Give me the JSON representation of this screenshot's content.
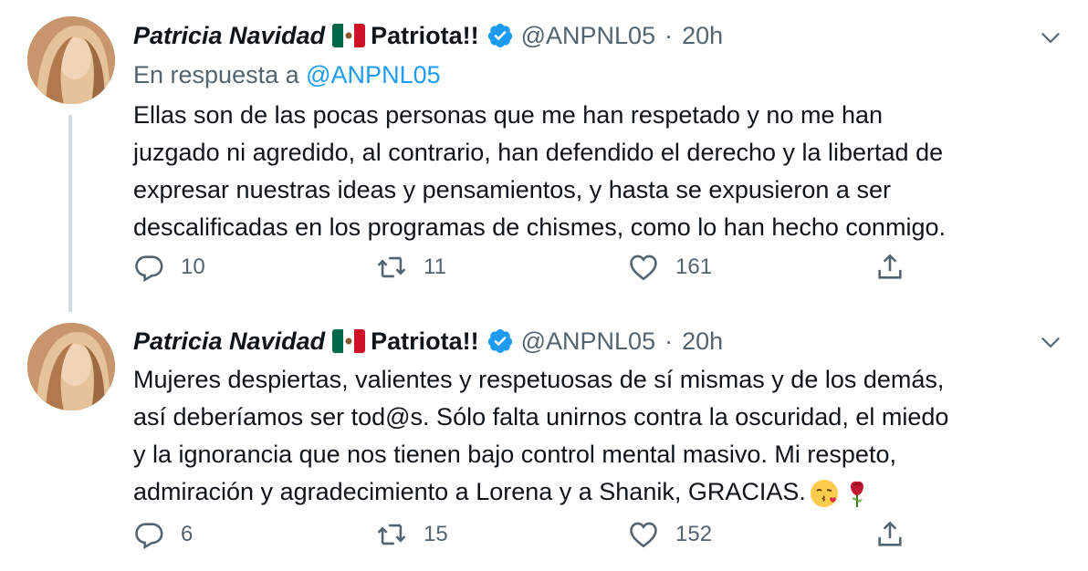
{
  "tweets": [
    {
      "display_name": "Patricia Navidad",
      "name_suffix": "Patriota!!",
      "handle": "@ANPNL05",
      "separator": "·",
      "time": "20h",
      "reply_prefix": "En respuesta a",
      "reply_handle": "@ANPNL05",
      "lines": [
        "Ellas son de las pocas personas que me han respetado y no me han",
        "juzgado ni agredido, al contrario, han defendido el derecho y la libertad de",
        "expresar nuestras ideas y pensamientos, y hasta se expusieron a ser",
        "descalificadas en los programas de chismes, como lo han hecho conmigo."
      ],
      "replies": "10",
      "retweets": "11",
      "likes": "161"
    },
    {
      "display_name": "Patricia Navidad",
      "name_suffix": "Patriota!!",
      "handle": "@ANPNL05",
      "separator": "·",
      "time": "20h",
      "lines": [
        "Mujeres despiertas, valientes y respetuosas de sí mismas y de los demás,",
        "así deberíamos ser tod@s. Sólo falta unirnos contra la oscuridad, el miedo",
        "y la ignorancia que nos tienen bajo control mental masivo. Mi respeto,",
        "admiración y agradecimiento a Lorena y a Shanik, GRACIAS."
      ],
      "emojis": [
        "face-blowing-kiss-emoji",
        "rose-emoji"
      ],
      "replies": "6",
      "retweets": "15",
      "likes": "152"
    }
  ],
  "icons": {
    "flag": "mexico-flag-icon",
    "verified": "verified-badge-icon",
    "caret": "chevron-down-icon",
    "reply": "reply-icon",
    "retweet": "retweet-icon",
    "like": "heart-icon",
    "share": "share-icon"
  },
  "colors": {
    "text": "#0f1419",
    "secondary": "#536471",
    "link": "#1d9bf0",
    "verified": "#1d9bf0"
  }
}
